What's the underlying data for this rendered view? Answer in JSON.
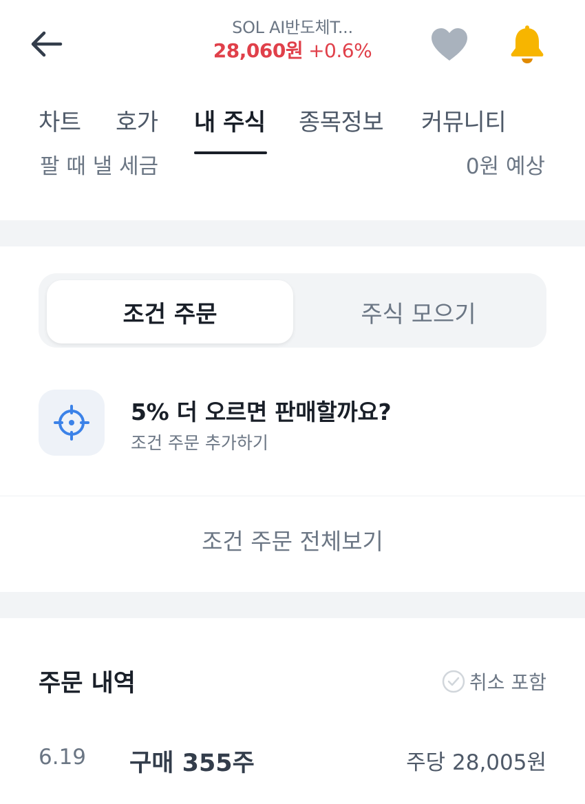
{
  "header": {
    "back_icon": "arrow-left-icon",
    "title": "SOL AI반도체T...",
    "price": "28,060원",
    "change": "+0.6%",
    "heart_icon": "heart-icon",
    "bell_icon": "bell-icon",
    "colors": {
      "price": "#e0404a",
      "heart": "#a9b2bd",
      "bell": "#f7b500"
    }
  },
  "tabs": [
    {
      "label": "차트"
    },
    {
      "label": "호가"
    },
    {
      "label": "내 주식"
    },
    {
      "label": "종목정보"
    },
    {
      "label": "커뮤니티"
    }
  ],
  "active_tab": "내 주식",
  "tax": {
    "label": "팔 때 낼 세금",
    "value": "0원 예상"
  },
  "segment": {
    "active": "조건 주문",
    "inactive": "주식 모으기"
  },
  "condition": {
    "icon": "target-icon",
    "title": "5% 더 오르면 판매할까요?",
    "subtitle": "조건 주문 추가하기"
  },
  "view_all": "조건 주문 전체보기",
  "orders": {
    "title": "주문 내역",
    "toggle_label": "취소 포함",
    "toggle_checked": false,
    "items": [
      {
        "date": "6.19",
        "desc": "구매 355주",
        "price": "주당 28,005원"
      }
    ]
  }
}
